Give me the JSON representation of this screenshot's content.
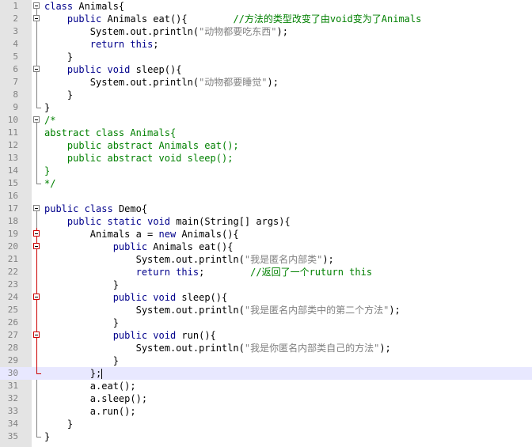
{
  "lines": [
    {
      "n": "1",
      "t": "class Animals{"
    },
    {
      "n": "2",
      "t": "    public Animals eat(){"
    },
    {
      "n": "3",
      "t": "        System.out.println(\"动物都要吃东西\");"
    },
    {
      "n": "4",
      "t": "        return this;"
    },
    {
      "n": "5",
      "t": "    }"
    },
    {
      "n": "6",
      "t": "    public void sleep(){"
    },
    {
      "n": "7",
      "t": "        System.out.println(\"动物都要睡觉\");"
    },
    {
      "n": "8",
      "t": "    }"
    },
    {
      "n": "9",
      "t": "}"
    },
    {
      "n": "10",
      "t": "/*"
    },
    {
      "n": "11",
      "t": "abstract class Animals{"
    },
    {
      "n": "12",
      "t": "    public abstract Animals eat();"
    },
    {
      "n": "13",
      "t": "    public abstract void sleep();"
    },
    {
      "n": "14",
      "t": "}"
    },
    {
      "n": "15",
      "t": "*/"
    },
    {
      "n": "16",
      "t": ""
    },
    {
      "n": "17",
      "t": "public class Demo{"
    },
    {
      "n": "18",
      "t": "    public static void main(String[] args){"
    },
    {
      "n": "19",
      "t": "        Animals a = new Animals(){"
    },
    {
      "n": "20",
      "t": "            public Animals eat(){"
    },
    {
      "n": "21",
      "t": "                System.out.println(\"我是匿名内部类\");"
    },
    {
      "n": "22",
      "t": "                return this;"
    },
    {
      "n": "23",
      "t": "            }"
    },
    {
      "n": "24",
      "t": "            public void sleep(){"
    },
    {
      "n": "25",
      "t": "                System.out.println(\"我是匿名内部类中的第二个方法\");"
    },
    {
      "n": "26",
      "t": "            }"
    },
    {
      "n": "27",
      "t": "            public void run(){"
    },
    {
      "n": "28",
      "t": "                System.out.println(\"我是你匿名内部类自己的方法\");"
    },
    {
      "n": "29",
      "t": "            }"
    },
    {
      "n": "30",
      "t": "        };"
    },
    {
      "n": "31",
      "t": "        a.eat();"
    },
    {
      "n": "32",
      "t": "        a.sleep();"
    },
    {
      "n": "33",
      "t": "        a.run();"
    },
    {
      "n": "34",
      "t": "    }"
    },
    {
      "n": "35",
      "t": "}"
    }
  ],
  "comments": {
    "line2": "//方法的类型改变了由void变为了Animals",
    "line22": "//返回了一个ruturn this"
  },
  "colors": {
    "keyword": "#00008b",
    "string": "#808080",
    "comment": "#008000",
    "gutter": "#e4e4e4",
    "active_line": "#e8e8ff",
    "fold_red": "#cc0000"
  },
  "active_line": "30"
}
